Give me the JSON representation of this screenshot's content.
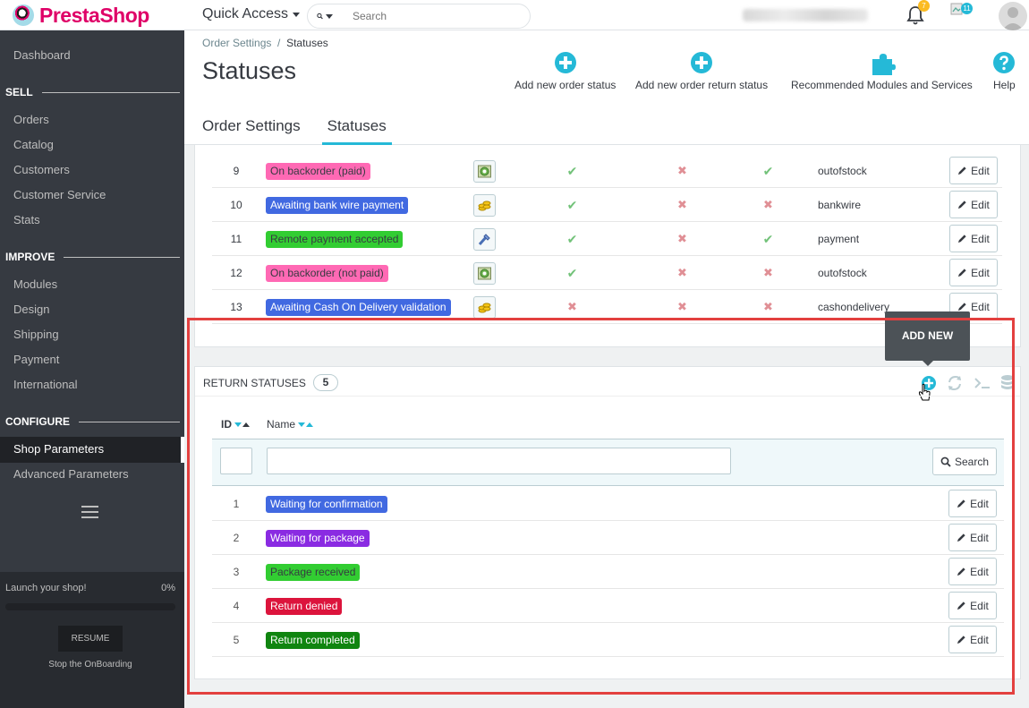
{
  "brand": {
    "name": "PrestaShop"
  },
  "topbar": {
    "quick_access": "Quick Access",
    "search_placeholder": "Search",
    "notifications_count": "7",
    "orders_count": "11"
  },
  "sidebar": {
    "dashboard": "Dashboard",
    "sections": [
      {
        "title": "SELL",
        "items": [
          "Orders",
          "Catalog",
          "Customers",
          "Customer Service",
          "Stats"
        ]
      },
      {
        "title": "IMPROVE",
        "items": [
          "Modules",
          "Design",
          "Shipping",
          "Payment",
          "International"
        ]
      },
      {
        "title": "CONFIGURE",
        "items": [
          "Shop Parameters",
          "Advanced Parameters"
        ]
      }
    ],
    "active_item": "Shop Parameters",
    "onboarding": {
      "launch_label": "Launch your shop!",
      "progress_text": "0%",
      "progress": 0,
      "resume_label": "RESUME",
      "stop_label": "Stop the OnBoarding"
    }
  },
  "header": {
    "breadcrumb_parent": "Order Settings",
    "breadcrumb_sep": "/",
    "breadcrumb_current": "Statuses",
    "title": "Statuses",
    "toolbar": [
      {
        "label": "Add new order status",
        "icon": "plus-circle-icon"
      },
      {
        "label": "Add new order return status",
        "icon": "plus-circle-icon"
      },
      {
        "label": "Recommended Modules and Services",
        "icon": "puzzle-icon"
      },
      {
        "label": "Help",
        "icon": "help-icon"
      }
    ],
    "tabs": [
      "Order Settings",
      "Statuses"
    ],
    "active_tab": "Statuses"
  },
  "order_statuses": {
    "edit_label": "Edit",
    "rows": [
      {
        "id": "9",
        "name": "On backorder (paid)",
        "color": "#ff69b4",
        "text_color": "#363a41",
        "icon": "backorder-icon",
        "send_email": true,
        "delivery": false,
        "invoice": true,
        "template": "outofstock"
      },
      {
        "id": "10",
        "name": "Awaiting bank wire payment",
        "color": "#4169e1",
        "text_color": "#ffffff",
        "icon": "coins-icon",
        "send_email": true,
        "delivery": false,
        "invoice": false,
        "template": "bankwire"
      },
      {
        "id": "11",
        "name": "Remote payment accepted",
        "color": "#32cd32",
        "text_color": "#363a41",
        "icon": "payment-icon",
        "send_email": true,
        "delivery": false,
        "invoice": true,
        "template": "payment"
      },
      {
        "id": "12",
        "name": "On backorder (not paid)",
        "color": "#ff69b4",
        "text_color": "#363a41",
        "icon": "backorder-icon",
        "send_email": true,
        "delivery": false,
        "invoice": false,
        "template": "outofstock"
      },
      {
        "id": "13",
        "name": "Awaiting Cash On Delivery validation",
        "color": "#4169e1",
        "text_color": "#ffffff",
        "icon": "coins-icon",
        "send_email": false,
        "delivery": false,
        "invoice": false,
        "template": "cashondelivery"
      }
    ]
  },
  "return_statuses": {
    "title": "RETURN STATUSES",
    "count": "5",
    "tooltip": "ADD NEW",
    "columns": {
      "id": "ID",
      "name": "Name"
    },
    "search_label": "Search",
    "edit_label": "Edit",
    "rows": [
      {
        "id": "1",
        "name": "Waiting for confirmation",
        "color": "#4169e1"
      },
      {
        "id": "2",
        "name": "Waiting for package",
        "color": "#8a2be2"
      },
      {
        "id": "3",
        "name": "Package received",
        "color": "#32cd32",
        "text_color": "#363a41"
      },
      {
        "id": "4",
        "name": "Return denied",
        "color": "#dc143c"
      },
      {
        "id": "5",
        "name": "Return completed",
        "color": "#108510"
      }
    ]
  },
  "colors": {
    "accent": "#25b9d7",
    "brand": "#df0067",
    "highlight": "#e3403f"
  }
}
